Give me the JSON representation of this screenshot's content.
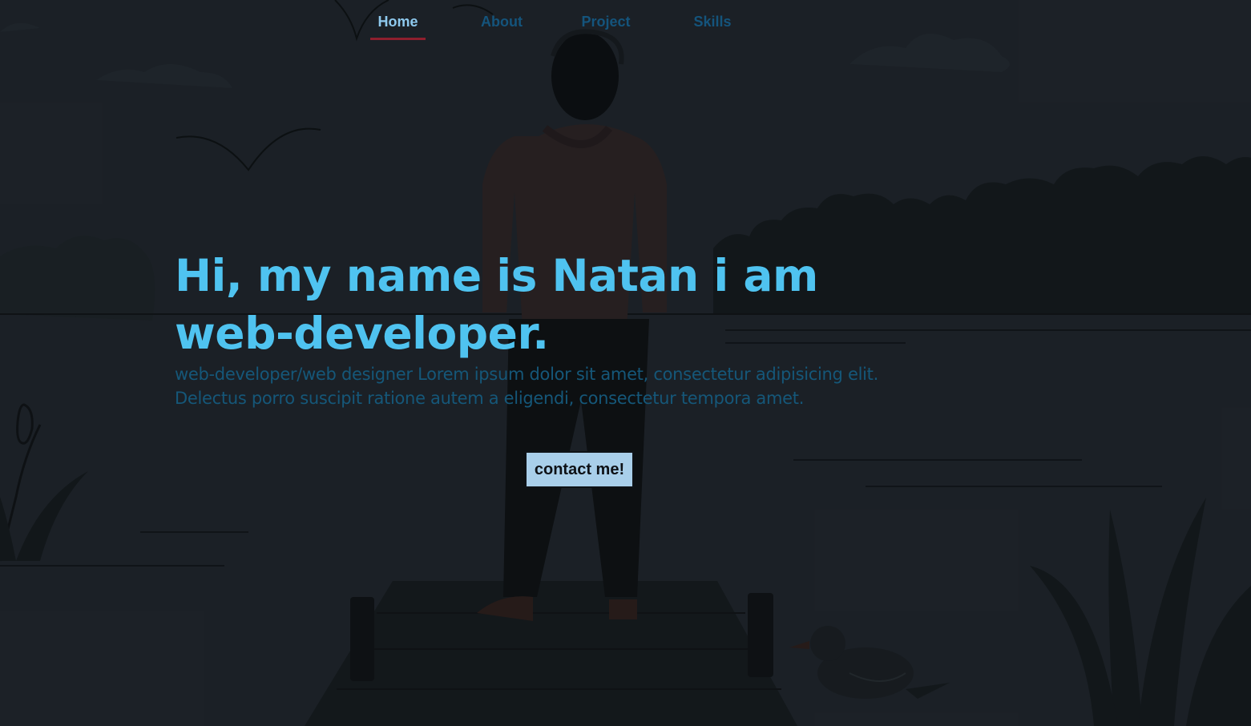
{
  "nav": {
    "items": [
      {
        "label": "Home",
        "active": true
      },
      {
        "label": "About",
        "active": false
      },
      {
        "label": "Project",
        "active": false
      },
      {
        "label": "Skills",
        "active": false
      }
    ]
  },
  "hero": {
    "title": "Hi, my name is Natan i am web-developer.",
    "subtitle": "web-developer/web designer Lorem ipsum dolor sit amet, consectetur adipisicing elit. Delectus porro suscipit ratione autem a eligendi, consectetur tempora amet.",
    "button_label": "contact me!"
  },
  "colors": {
    "background": "#1d2228",
    "title": "#4fc3f0",
    "subtitle": "#155779",
    "nav_inactive": "#14547c",
    "nav_active": "#8ec9ee",
    "nav_underline": "#8f1f2e",
    "button_bg": "#a9cfea"
  }
}
